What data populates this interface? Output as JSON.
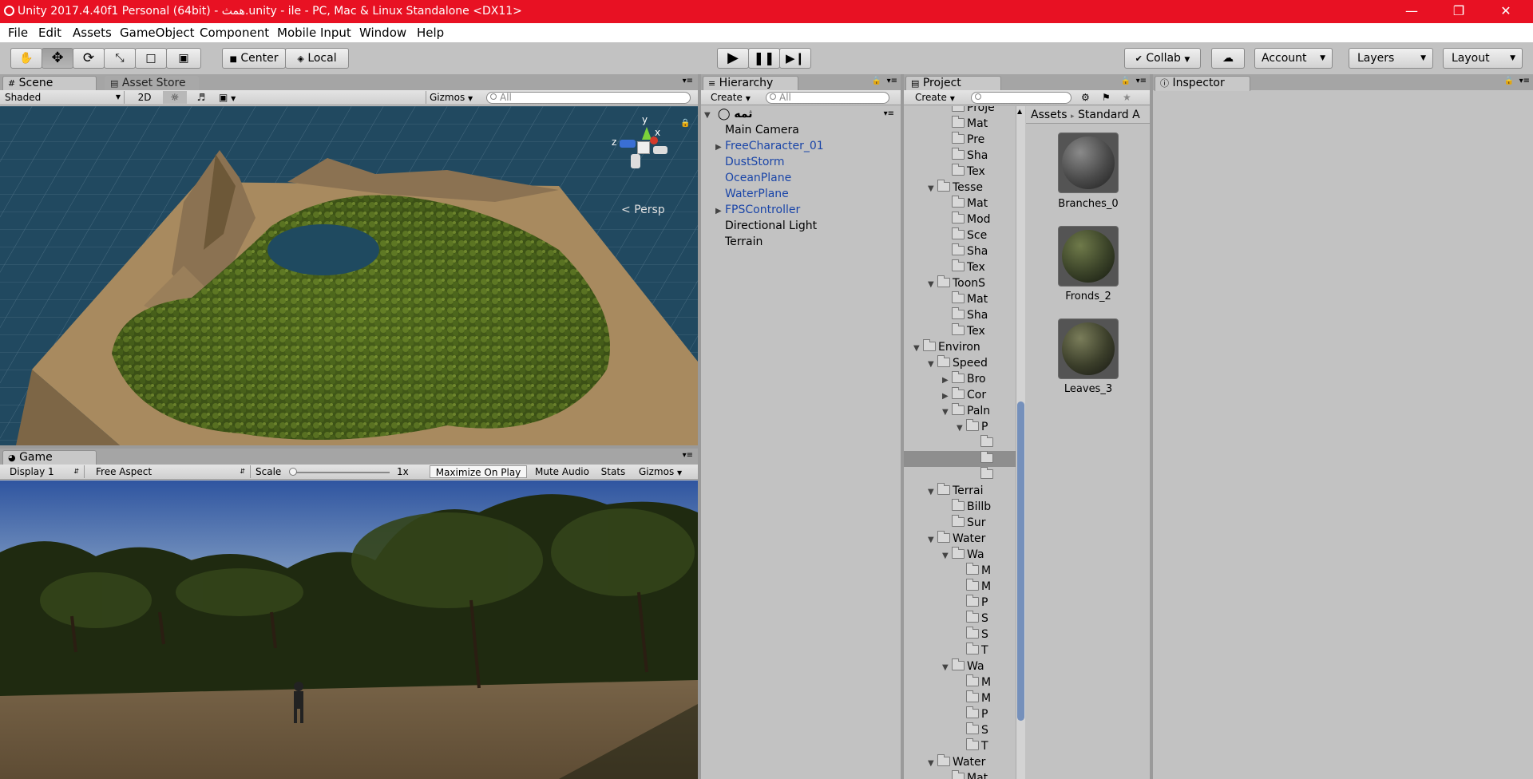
{
  "window": {
    "title": "Unity 2017.4.40f1 Personal (64bit) - همث.unity - ile - PC, Mac & Linux Standalone <DX11>",
    "controls": [
      "minimize",
      "restore",
      "close"
    ]
  },
  "menu": [
    "File",
    "Edit",
    "Assets",
    "GameObject",
    "Component",
    "Mobile Input",
    "Window",
    "Help"
  ],
  "toolbar": {
    "pivot_label": "Center",
    "space_label": "Local",
    "collab_label": "Collab",
    "account_label": "Account",
    "layers_label": "Layers",
    "layout_label": "Layout"
  },
  "scene": {
    "tab_label": "Scene",
    "asset_store_label": "Asset Store",
    "shading_mode": "Shaded",
    "mode_2d": "2D",
    "gizmos_label": "Gizmos",
    "search_placeholder": "All",
    "axis_y": "y",
    "axis_x": "x",
    "axis_z": "z",
    "projection_label": "Persp"
  },
  "game": {
    "tab_label": "Game",
    "display": "Display 1",
    "aspect": "Free Aspect",
    "scale_label": "Scale",
    "scale_value": "1x",
    "maximize_label": "Maximize On Play",
    "mute_label": "Mute Audio",
    "stats_label": "Stats",
    "gizmos_label": "Gizmos"
  },
  "hierarchy": {
    "tab_label": "Hierarchy",
    "create_label": "Create",
    "search_placeholder": "All",
    "scene_name": "ثمه",
    "items": [
      {
        "label": "Main Camera",
        "prefab": false,
        "expandable": false
      },
      {
        "label": "FreeCharacter_01",
        "prefab": true,
        "expandable": true
      },
      {
        "label": "DustStorm",
        "prefab": true,
        "expandable": false
      },
      {
        "label": "OceanPlane",
        "prefab": true,
        "expandable": false
      },
      {
        "label": "WaterPlane",
        "prefab": true,
        "expandable": false
      },
      {
        "label": "FPSController",
        "prefab": true,
        "expandable": true
      },
      {
        "label": "Directional Light",
        "prefab": false,
        "expandable": false
      },
      {
        "label": "Terrain",
        "prefab": false,
        "expandable": false
      }
    ]
  },
  "project": {
    "tab_label": "Project",
    "create_label": "Create",
    "breadcrumb_root": "Assets",
    "breadcrumb_next": "Standard A",
    "tree": [
      {
        "label": "Proje",
        "depth": 4,
        "arrow": ""
      },
      {
        "label": "Mat",
        "depth": 4,
        "arrow": ""
      },
      {
        "label": "Pre",
        "depth": 4,
        "arrow": ""
      },
      {
        "label": "Sha",
        "depth": 4,
        "arrow": ""
      },
      {
        "label": "Tex",
        "depth": 4,
        "arrow": ""
      },
      {
        "label": "Tesse",
        "depth": 3,
        "arrow": "▼"
      },
      {
        "label": "Mat",
        "depth": 4,
        "arrow": ""
      },
      {
        "label": "Mod",
        "depth": 4,
        "arrow": ""
      },
      {
        "label": "Sce",
        "depth": 4,
        "arrow": ""
      },
      {
        "label": "Sha",
        "depth": 4,
        "arrow": ""
      },
      {
        "label": "Tex",
        "depth": 4,
        "arrow": ""
      },
      {
        "label": "ToonS",
        "depth": 3,
        "arrow": "▼"
      },
      {
        "label": "Mat",
        "depth": 4,
        "arrow": ""
      },
      {
        "label": "Sha",
        "depth": 4,
        "arrow": ""
      },
      {
        "label": "Tex",
        "depth": 4,
        "arrow": ""
      },
      {
        "label": "Environ",
        "depth": 2,
        "arrow": "▼"
      },
      {
        "label": "Speed",
        "depth": 3,
        "arrow": "▼"
      },
      {
        "label": "Bro",
        "depth": 4,
        "arrow": "▶"
      },
      {
        "label": "Cor",
        "depth": 4,
        "arrow": "▶"
      },
      {
        "label": "Paln",
        "depth": 4,
        "arrow": "▼"
      },
      {
        "label": "P",
        "depth": 5,
        "arrow": "▼"
      },
      {
        "label": "",
        "depth": 6,
        "arrow": ""
      },
      {
        "label": "",
        "depth": 6,
        "arrow": "",
        "selected": true
      },
      {
        "label": "",
        "depth": 6,
        "arrow": ""
      },
      {
        "label": "Terrai",
        "depth": 3,
        "arrow": "▼"
      },
      {
        "label": "Billb",
        "depth": 4,
        "arrow": ""
      },
      {
        "label": "Sur",
        "depth": 4,
        "arrow": ""
      },
      {
        "label": "Water",
        "depth": 3,
        "arrow": "▼"
      },
      {
        "label": "Wa",
        "depth": 4,
        "arrow": "▼"
      },
      {
        "label": "M",
        "depth": 5,
        "arrow": ""
      },
      {
        "label": "M",
        "depth": 5,
        "arrow": ""
      },
      {
        "label": "P",
        "depth": 5,
        "arrow": ""
      },
      {
        "label": "S",
        "depth": 5,
        "arrow": ""
      },
      {
        "label": "S",
        "depth": 5,
        "arrow": ""
      },
      {
        "label": "T",
        "depth": 5,
        "arrow": ""
      },
      {
        "label": "Wa",
        "depth": 4,
        "arrow": "▼"
      },
      {
        "label": "M",
        "depth": 5,
        "arrow": ""
      },
      {
        "label": "M",
        "depth": 5,
        "arrow": ""
      },
      {
        "label": "P",
        "depth": 5,
        "arrow": ""
      },
      {
        "label": "S",
        "depth": 5,
        "arrow": ""
      },
      {
        "label": "T",
        "depth": 5,
        "arrow": ""
      },
      {
        "label": "Water",
        "depth": 3,
        "arrow": "▼"
      },
      {
        "label": "Mat",
        "depth": 4,
        "arrow": ""
      }
    ],
    "assets": [
      {
        "label": "Branches_0",
        "kind": "branches"
      },
      {
        "label": "Fronds_2",
        "kind": "fronds"
      },
      {
        "label": "Leaves_3",
        "kind": "leaves"
      }
    ]
  },
  "inspector": {
    "tab_label": "Inspector"
  }
}
